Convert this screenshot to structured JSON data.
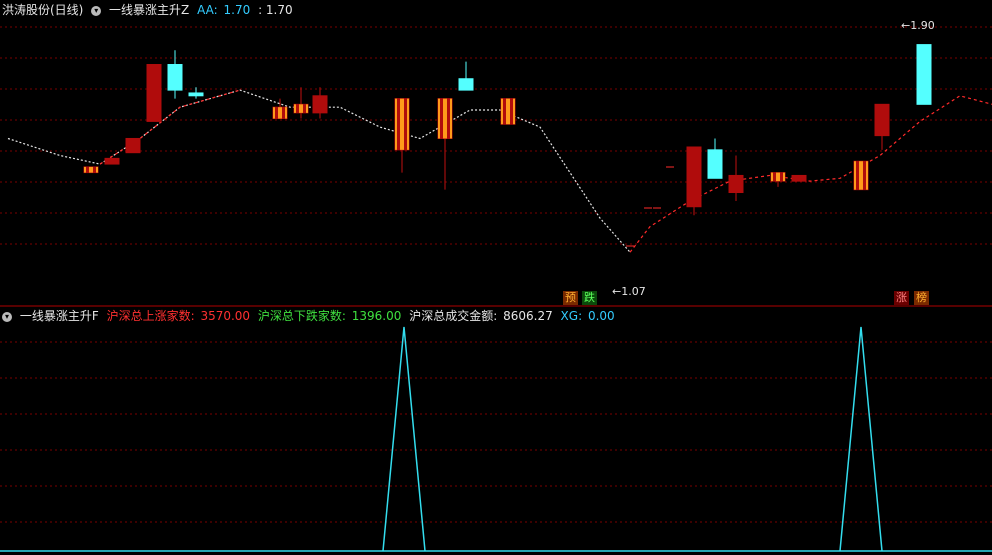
{
  "colors": {
    "up": "#ff2a2a",
    "down": "#54ffff",
    "white": "#e6e6e6",
    "green": "#3fe03f",
    "cyan": "#33ccff",
    "grid": "#7a0000"
  },
  "main_header": {
    "stock_name": "洪涛股份(日线)",
    "indicator_name": "一线暴涨主升Z",
    "aa_label": "AA:",
    "aa_value": "1.70",
    "aa_extra": ": 1.70"
  },
  "main_annotations": {
    "low_marker": "1.07",
    "high_marker": "1.90",
    "badge_1": "预",
    "badge_2": "跌",
    "badge_3": "涨",
    "badge_4": "榜"
  },
  "sub_header": {
    "indicator_name": "一线暴涨主升F",
    "up_count_label": "沪深总上涨家数:",
    "up_count_value": "3570.00",
    "down_count_label": "沪深总下跌家数:",
    "down_count_value": "1396.00",
    "turnover_label": "沪深总成交金额:",
    "turnover_value": "8606.27",
    "xg_label": "XG:",
    "xg_value": "0.00"
  },
  "chart_data": {
    "type": "candlestick",
    "candles": [
      {
        "o": 1.4,
        "c": 1.42,
        "h": 1.42,
        "l": 1.4,
        "style": "hollow-up"
      },
      {
        "o": 1.43,
        "c": 1.45,
        "h": 1.45,
        "l": 1.43,
        "style": "solid-up"
      },
      {
        "o": 1.47,
        "c": 1.52,
        "h": 1.52,
        "l": 1.47,
        "style": "solid-up"
      },
      {
        "o": 1.58,
        "c": 1.78,
        "h": 1.78,
        "l": 1.58,
        "style": "solid-up"
      },
      {
        "o": 1.78,
        "c": 1.69,
        "h": 1.83,
        "l": 1.66,
        "style": "down"
      },
      {
        "o": 1.68,
        "c": 1.67,
        "h": 1.7,
        "l": 1.66,
        "style": "down"
      },
      {
        "o": 1.63,
        "c": 1.59,
        "h": 1.66,
        "l": 1.59,
        "style": "hollow-up"
      },
      {
        "o": 1.61,
        "c": 1.64,
        "h": 1.7,
        "l": 1.59,
        "style": "hollow-up"
      },
      {
        "o": 1.61,
        "c": 1.67,
        "h": 1.7,
        "l": 1.59,
        "style": "solid-up"
      },
      {
        "o": 1.66,
        "c": 1.48,
        "h": 1.66,
        "l": 1.4,
        "style": "hollow-up"
      },
      {
        "o": 1.66,
        "c": 1.52,
        "h": 1.66,
        "l": 1.34,
        "style": "hollow-up"
      },
      {
        "o": 1.73,
        "c": 1.69,
        "h": 1.79,
        "l": 1.69,
        "style": "down"
      },
      {
        "o": 1.57,
        "c": 1.66,
        "h": 1.66,
        "l": 1.57,
        "style": "hollow-up"
      },
      {
        "o": 1.49,
        "c": 1.28,
        "h": 1.49,
        "l": 1.25,
        "style": "solid-up"
      },
      {
        "o": 1.48,
        "c": 1.38,
        "h": 1.52,
        "l": 1.38,
        "style": "down"
      },
      {
        "o": 1.39,
        "c": 1.33,
        "h": 1.46,
        "l": 1.3,
        "style": "solid-up"
      },
      {
        "o": 1.4,
        "c": 1.37,
        "h": 1.4,
        "l": 1.35,
        "style": "hollow-up"
      },
      {
        "o": 1.39,
        "c": 1.37,
        "h": 1.39,
        "l": 1.37,
        "style": "solid-up"
      },
      {
        "o": 1.44,
        "c": 1.34,
        "h": 1.44,
        "l": 1.34,
        "style": "hollow-up"
      },
      {
        "o": 1.53,
        "c": 1.64,
        "h": 1.64,
        "l": 1.48,
        "style": "solid-up"
      },
      {
        "o": 1.64,
        "c": 1.85,
        "h": 1.85,
        "l": 1.64,
        "style": "down"
      }
    ],
    "candle_x": [
      91,
      112,
      133,
      154,
      175,
      196,
      280,
      301,
      320,
      402,
      445,
      466,
      508,
      694,
      715,
      736,
      778,
      799,
      861,
      882,
      924
    ],
    "ma_points": [
      [
        8,
        1.52
      ],
      [
        60,
        1.46
      ],
      [
        100,
        1.43
      ],
      [
        140,
        1.52
      ],
      [
        180,
        1.63
      ],
      [
        240,
        1.69
      ],
      [
        290,
        1.63
      ],
      [
        340,
        1.63
      ],
      [
        380,
        1.56
      ],
      [
        420,
        1.52
      ],
      [
        470,
        1.62
      ],
      [
        500,
        1.62
      ],
      [
        540,
        1.56
      ],
      [
        570,
        1.4
      ],
      [
        600,
        1.24
      ],
      [
        630,
        1.12
      ],
      [
        650,
        1.21
      ],
      [
        690,
        1.3
      ],
      [
        730,
        1.37
      ],
      [
        770,
        1.39
      ],
      [
        810,
        1.37
      ],
      [
        840,
        1.38
      ],
      [
        880,
        1.46
      ],
      [
        920,
        1.58
      ],
      [
        960,
        1.67
      ],
      [
        992,
        1.64
      ]
    ],
    "ma_dash_red_from": 630,
    "ylim": [
      1.04,
      1.94
    ],
    "sub_peaks": [
      {
        "start": 383,
        "peak": 404,
        "end": 425
      },
      {
        "start": 840,
        "peak": 861,
        "end": 882
      }
    ]
  }
}
